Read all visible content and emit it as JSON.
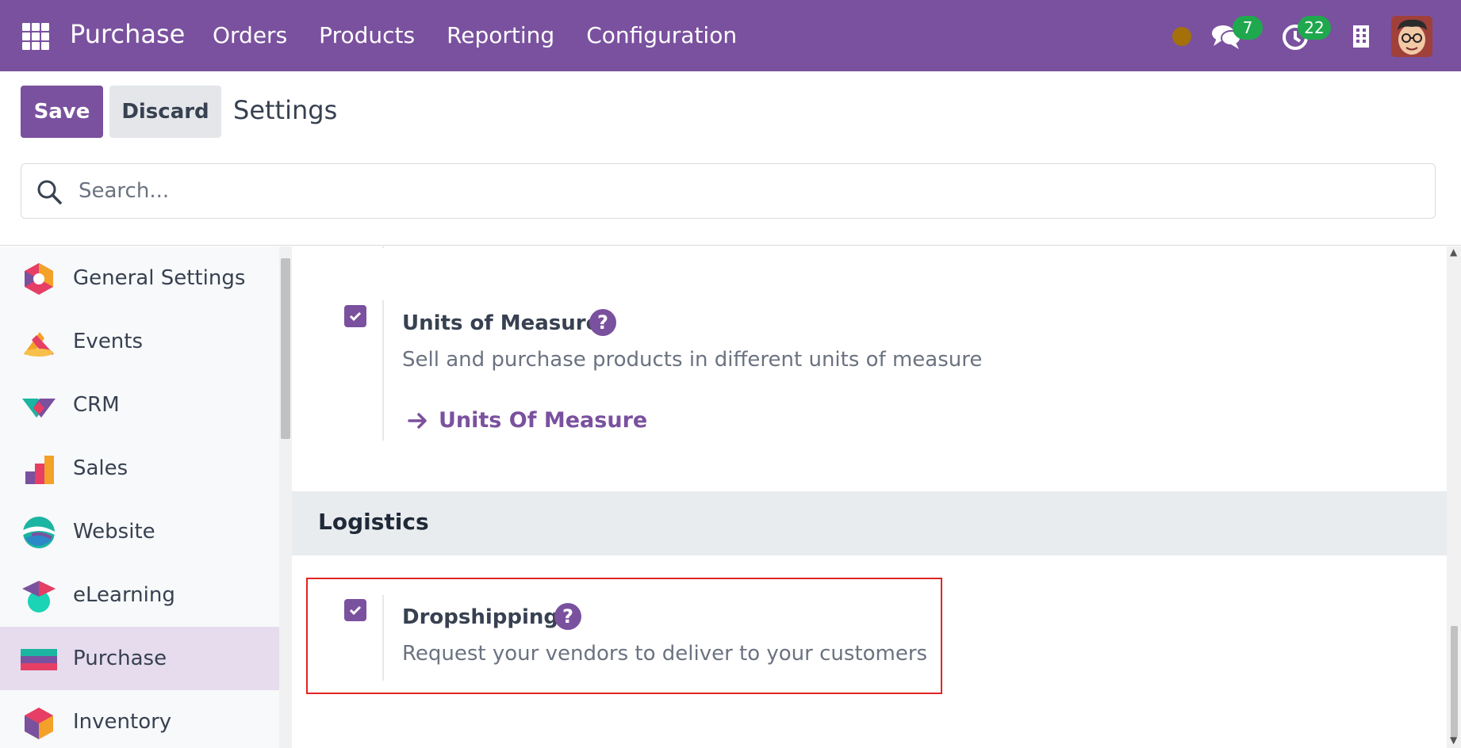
{
  "navbar": {
    "brand": "Purchase",
    "menu": [
      "Orders",
      "Products",
      "Reporting",
      "Configuration"
    ],
    "chat_count": "7",
    "activity_count": "22",
    "colors": {
      "bg": "#7a519e",
      "badge": "#1fa84e",
      "status": "#a5700a"
    }
  },
  "control": {
    "save_label": "Save",
    "discard_label": "Discard",
    "title": "Settings",
    "search_placeholder": "Search..."
  },
  "sidebar": {
    "items": [
      {
        "label": "General Settings",
        "icon": "general-settings-icon"
      },
      {
        "label": "Events",
        "icon": "events-icon"
      },
      {
        "label": "CRM",
        "icon": "crm-icon"
      },
      {
        "label": "Sales",
        "icon": "sales-icon"
      },
      {
        "label": "Website",
        "icon": "website-icon"
      },
      {
        "label": "eLearning",
        "icon": "elearning-icon"
      },
      {
        "label": "Purchase",
        "icon": "purchase-icon",
        "active": true
      },
      {
        "label": "Inventory",
        "icon": "inventory-icon"
      }
    ]
  },
  "main": {
    "uom": {
      "title": "Units of Measure",
      "description": "Sell and purchase products in different units of measure",
      "link": "Units Of Measure",
      "checked": true
    },
    "section_title": "Logistics",
    "dropshipping": {
      "title": "Dropshipping",
      "description": "Request your vendors to deliver to your customers",
      "checked": true
    }
  }
}
